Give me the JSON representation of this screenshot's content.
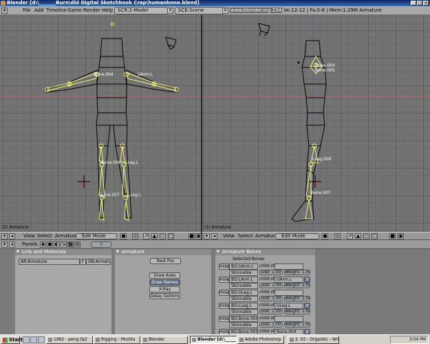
{
  "window": {
    "title": "Blender [d:\\_______Burn\\dld Digital Sketchbook Crap\\humanbone.blend]",
    "controls": [
      "_",
      "□",
      "×"
    ]
  },
  "menubar": {
    "items": [
      "File",
      "Add",
      "Timeline",
      "Game",
      "Render",
      "Help"
    ],
    "screen_field": "SCR:2-Model",
    "scene_field": "SCE:Scene",
    "url": "www.blender.org 234",
    "info": "Ve:12-12 | Fa:0-8 | Mem:1.29M Armature",
    "close_glyph": "X"
  },
  "viewport_left": {
    "label": "(1) Armature",
    "bone_labels": [
      "Bone.004",
      "UArm.L",
      "Bone.006",
      "LLeg.L",
      "Bone.007",
      "LLeg.L"
    ]
  },
  "viewport_right": {
    "label": "(1) Armature",
    "bone_labels": [
      "Bone.004",
      "Bone.005",
      "LLeg.006",
      "Bone.007"
    ]
  },
  "view_header": {
    "items": [
      "View",
      "Select",
      "Armature"
    ],
    "mode": "Edit Mode"
  },
  "buttons_header": {
    "panels_label": "Panels",
    "frame": "1"
  },
  "panels": {
    "link": {
      "title": "Link and Materials",
      "ar_field": "AR:Armature",
      "f_label": "F",
      "ob_field": "OB:Armature"
    },
    "armature": {
      "title": "Armature",
      "rest_pos": "Rest Pos",
      "draw_axes": "Draw Axes",
      "draw_names": "Draw Names",
      "xray": "X-Ray",
      "delay_deform": "Delay Deform"
    },
    "bones": {
      "title": "Armature Bones",
      "selected_label": "Selected Bones",
      "hide_label": "Hide",
      "child_of_label": "child of",
      "rows": [
        {
          "name": "BO:UArm.L",
          "parent": "",
          "mode": "Skinnable",
          "dist": "Dist: 1.00",
          "weight": "Weight: 1.00"
        },
        {
          "name": "BO:LArm.L",
          "parent": "UArm.L",
          "mode": "Skinnable",
          "dist": "Dist: 1.00",
          "weight": "Weight: 1.00"
        },
        {
          "name": "BO:ULeg.L",
          "parent": "",
          "mode": "Skinnable",
          "dist": "Dist: 1.00",
          "weight": "Weight: 1.00"
        },
        {
          "name": "BO:LLeg.L",
          "parent": "ULeg.L",
          "mode": "Skinnable",
          "dist": "Dist: 1.00",
          "weight": "Weight: 1.00"
        },
        {
          "name": "BO:Bone.004",
          "parent": "",
          "mode": "Skinnable",
          "dist": "Dist: 1.00",
          "weight": "Weight: 1.00"
        },
        {
          "name": "BO:Bone.005",
          "parent": "Bone.004",
          "mode": "",
          "dist": "",
          "weight": ""
        }
      ]
    }
  },
  "taskbar": {
    "start": "Start",
    "tasks": [
      "1992 - peng [lp]",
      "Rigging - Mozilla",
      "Blender",
      "Blender [d:\\_______",
      "Adobe Photoshop",
      "2. 02 - Orgaistic - Win..."
    ],
    "active_index": 3,
    "clock": "3:04 PM"
  }
}
